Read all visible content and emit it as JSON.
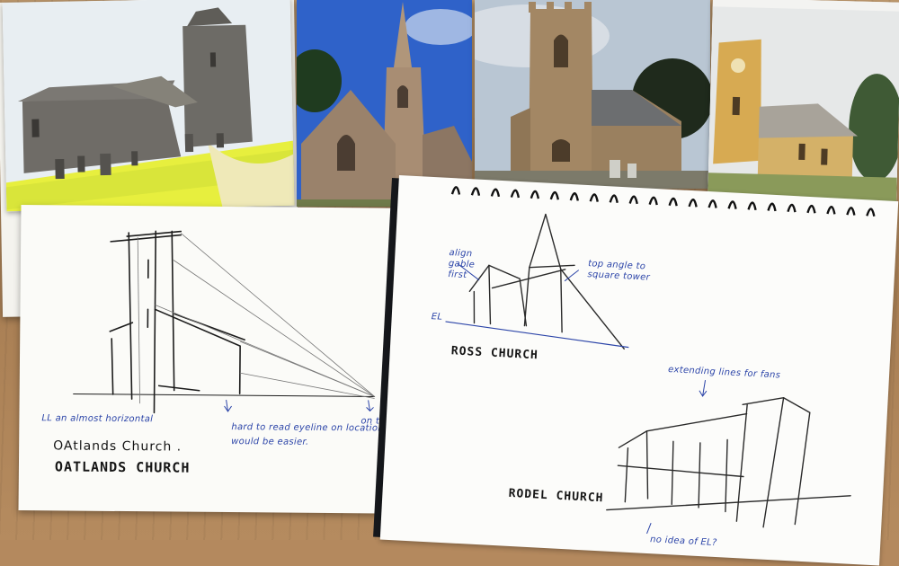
{
  "photos": [
    {
      "subject": "stone church with square tower and graveyard"
    },
    {
      "subject": "sandstone gothic church with spire"
    },
    {
      "subject": "sandstone church with square crenellated tower"
    },
    {
      "subject": "yellow church with square tower"
    }
  ],
  "sheet_left": {
    "notes": {
      "horizon": "LL an almost horizontal",
      "eyeline": "hard to read eyeline on location would be easier.",
      "on_page": "on the page"
    },
    "captions": {
      "line1": "OAtlands Church .",
      "line2": "OATLANDS CHURCH"
    }
  },
  "sketchbook": {
    "notes": {
      "gable": "align gable first",
      "top_angle": "top angle to square tower",
      "el": "EL",
      "extending": "extending lines for fans",
      "no_idea": "no idea of EL?"
    },
    "captions": {
      "ross": "ROSS CHURCH",
      "rodel": "RODEL CHURCH"
    }
  },
  "colors": {
    "ink": "#151515",
    "pen_blue": "#2b44a8",
    "wood": "#b4895e"
  }
}
